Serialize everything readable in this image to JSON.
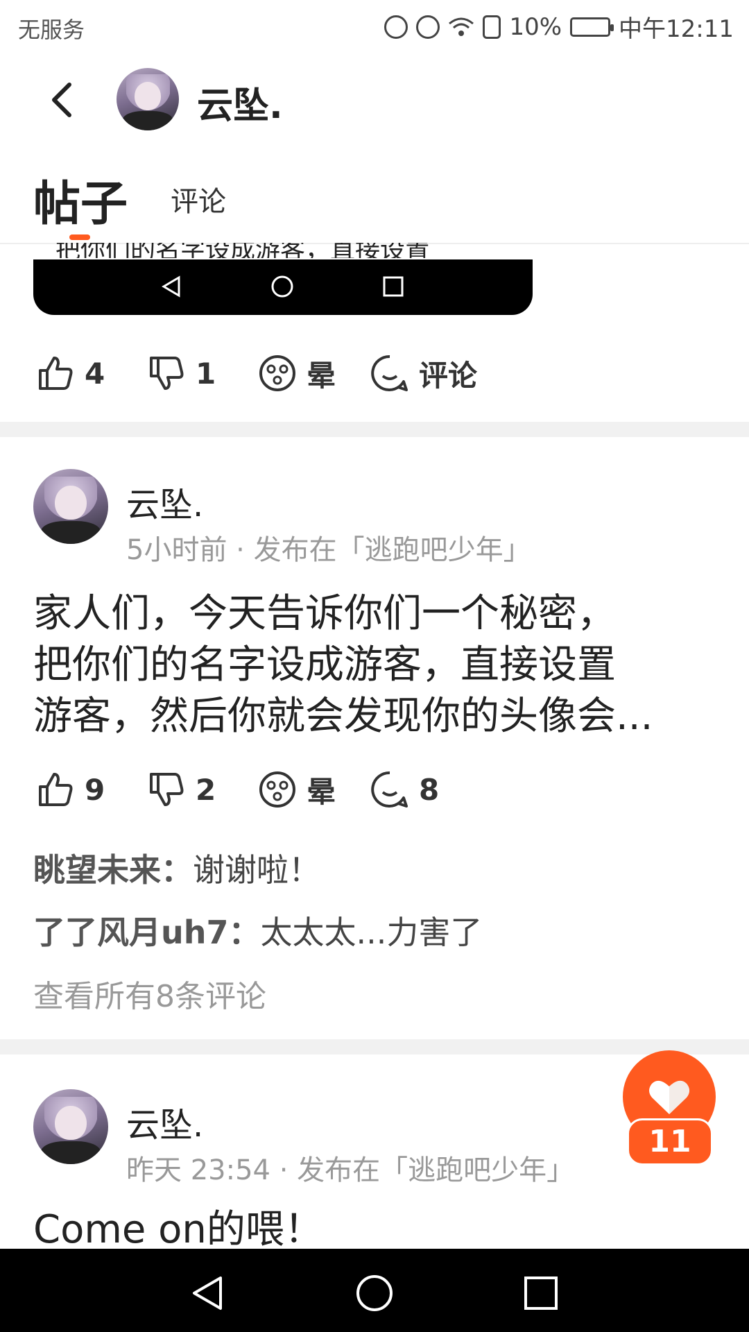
{
  "status_bar": {
    "carrier": "无服务",
    "battery": "10%",
    "time": "中午12:11",
    "icons": [
      "hd-call-icon",
      "alarm-icon",
      "wifi-icon",
      "battery-alert-icon",
      "battery-icon"
    ]
  },
  "header": {
    "back_icon": "chevron-left-icon",
    "username": "云坠."
  },
  "tabs": [
    {
      "label": "帖子",
      "active": true
    },
    {
      "label": "评论",
      "active": false
    }
  ],
  "first_post": {
    "peek_text": "把你们的名字设成游客，直接设置",
    "actions": {
      "like": "4",
      "dislike": "1",
      "dizzy": "晕",
      "comment": "评论"
    }
  },
  "posts": [
    {
      "author": "云坠.",
      "meta": "5小时前 · 发布在「逃跑吧少年」",
      "body_lines": [
        "家人们，今天告诉你们一个秘密，",
        "把你们的名字设成游客，直接设置",
        "游客，然后你就会发现你的头像会..."
      ],
      "actions": {
        "like": "9",
        "dislike": "2",
        "dizzy": "晕",
        "comment": "8"
      },
      "comments": [
        {
          "author": "眺望未来：",
          "text": "谢谢啦！"
        },
        {
          "author": "了了风月uh7：",
          "text": "太太太...力害了"
        }
      ],
      "view_all": "查看所有8条评论"
    },
    {
      "author": "云坠.",
      "meta": "昨天 23:54 · 发布在「逃跑吧少年」",
      "body_lines": [
        "Come on的喂！"
      ]
    }
  ],
  "fab": {
    "icon": "heart-icon",
    "count": "11"
  },
  "colors": {
    "accent": "#ff5a1f",
    "meta": "#999999",
    "divider": "#f1f1f1"
  }
}
